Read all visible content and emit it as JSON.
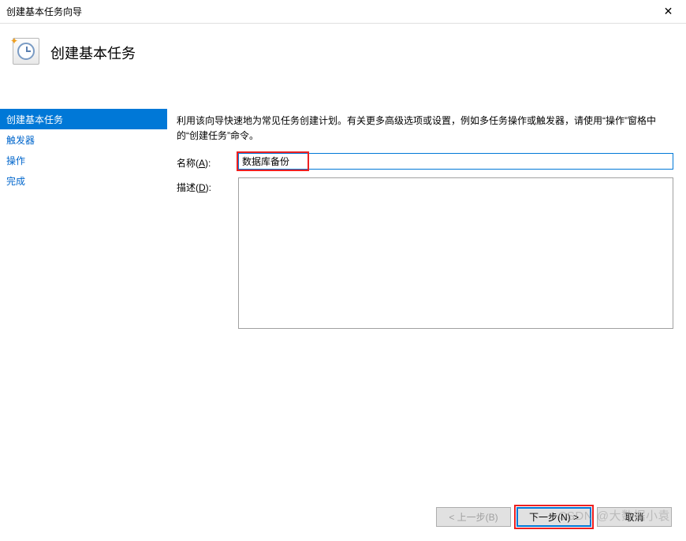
{
  "window": {
    "title": "创建基本任务向导",
    "close_icon": "✕"
  },
  "header": {
    "title": "创建基本任务"
  },
  "sidebar": {
    "items": [
      {
        "label": "创建基本任务",
        "active": true
      },
      {
        "label": "触发器",
        "active": false
      },
      {
        "label": "操作",
        "active": false
      },
      {
        "label": "完成",
        "active": false
      }
    ]
  },
  "main": {
    "intro": "利用该向导快速地为常见任务创建计划。有关更多高级选项或设置，例如多任务操作或触发器，请使用“操作”窗格中的“创建任务”命令。",
    "name_label_pre": "名称(",
    "name_label_key": "A",
    "name_label_post": "):",
    "name_value": "数据库备份",
    "desc_label_pre": "描述(",
    "desc_label_key": "D",
    "desc_label_post": "):",
    "desc_value": ""
  },
  "buttons": {
    "back": "< 上一步(B)",
    "next": "下一步(N) >",
    "cancel": "取消"
  },
  "watermark": "CSDN @大数据小袁"
}
